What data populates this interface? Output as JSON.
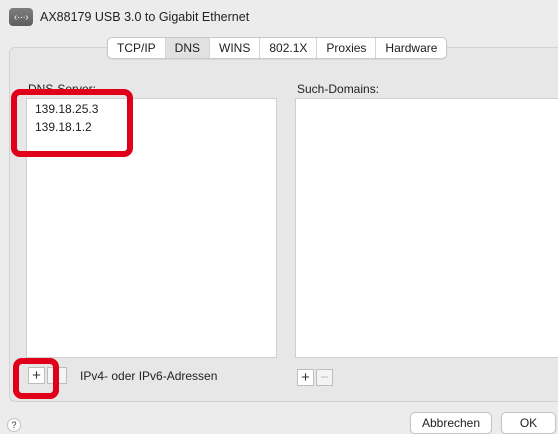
{
  "header": {
    "icon": "network-dots-icon",
    "icon_glyph": "‹···›",
    "title": "AX88179 USB 3.0 to Gigabit Ethernet"
  },
  "tabs": [
    {
      "label": "TCP/IP",
      "active": false
    },
    {
      "label": "DNS",
      "active": true
    },
    {
      "label": "WINS",
      "active": false
    },
    {
      "label": "802.1X",
      "active": false
    },
    {
      "label": "Proxies",
      "active": false
    },
    {
      "label": "Hardware",
      "active": false
    }
  ],
  "dns_servers": {
    "label": "DNS-Server:",
    "entries": [
      "139.18.25.3",
      "139.18.1.2"
    ],
    "add": "+",
    "hint": "IPv4- oder IPv6-Adressen"
  },
  "search_domains": {
    "label": "Such-Domains:",
    "entries": [],
    "add": "+",
    "remove": "−"
  },
  "footer": {
    "help": "?",
    "cancel": "Abbrechen",
    "ok": "OK"
  },
  "colors": {
    "highlight": "#e00019",
    "panel": "#e7e7e7",
    "window": "#ececec"
  }
}
